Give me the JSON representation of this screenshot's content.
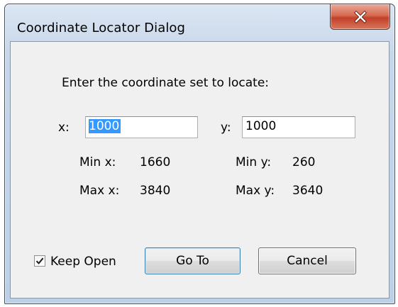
{
  "window": {
    "title": "Coordinate Locator Dialog",
    "close_icon": "close-x-icon",
    "close_color": "#c7432b"
  },
  "prompt": "Enter the coordinate set to locate:",
  "x_field": {
    "label": "x:",
    "value": "1000",
    "selected": true
  },
  "y_field": {
    "label": "y:",
    "value": "1000"
  },
  "ranges": {
    "min_x_label": "Min x:",
    "min_x_value": "1660",
    "max_x_label": "Max x:",
    "max_x_value": "3840",
    "min_y_label": "Min y:",
    "min_y_value": "260",
    "max_y_label": "Max y:",
    "max_y_value": "3640"
  },
  "keep_open": {
    "label": "Keep Open",
    "checked": true
  },
  "buttons": {
    "goto_label": "Go To",
    "cancel_label": "Cancel"
  }
}
